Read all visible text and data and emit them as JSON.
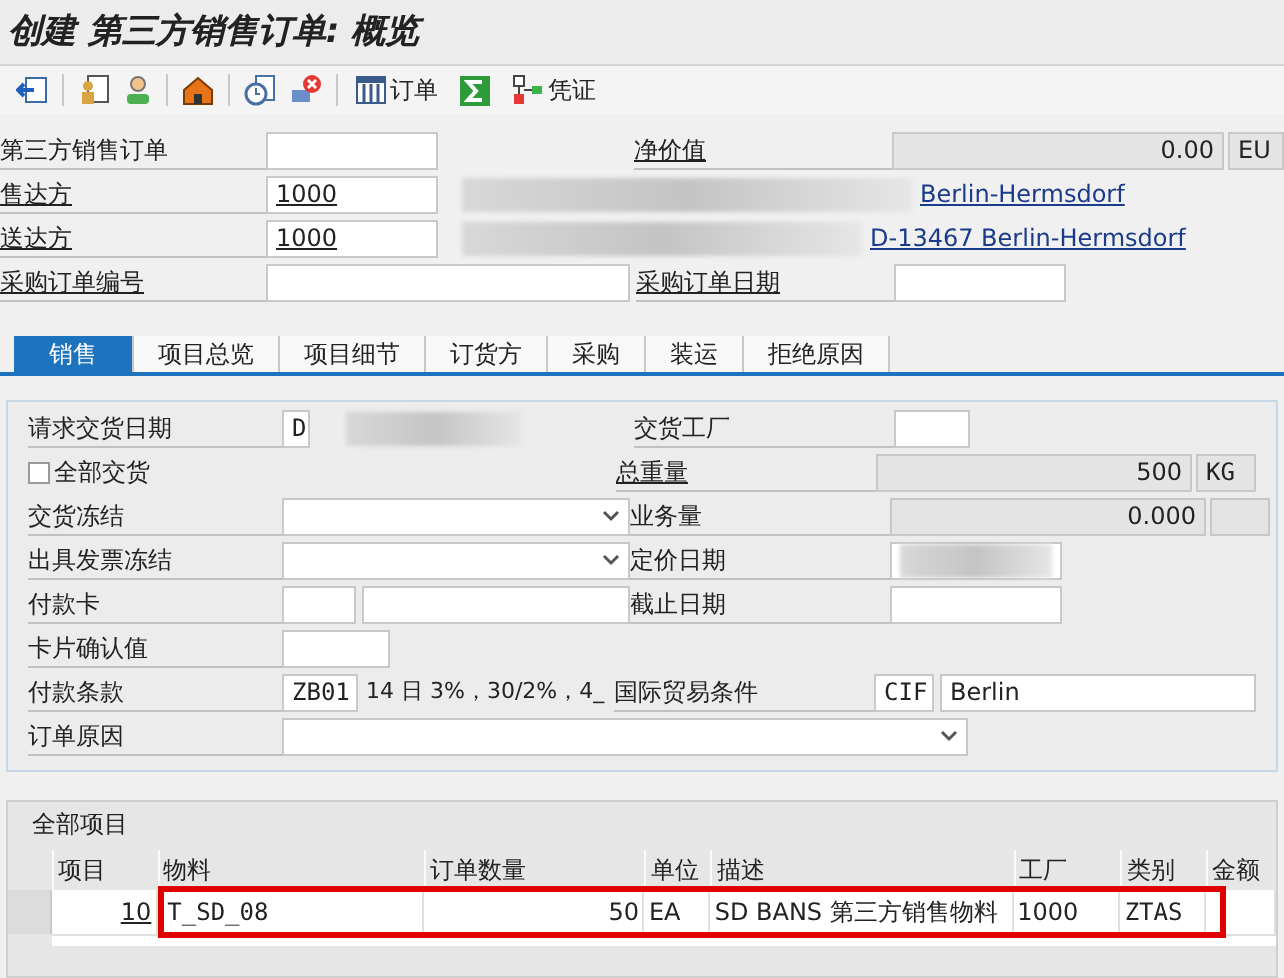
{
  "window": {
    "title": "创建 第三方销售订单: 概览"
  },
  "toolbar": {
    "order_button": "订单",
    "document_button": "凭证"
  },
  "header": [
    {
      "label": "第三方销售订单",
      "right_label": "净价值",
      "right_value": "0.00",
      "unit": "EU"
    },
    {
      "label": "售达方",
      "value": "1000",
      "address": "Berlin-Hermsdorf"
    },
    {
      "label": "送达方",
      "value": "1000",
      "address": "D-13467 Berlin-Hermsdorf"
    },
    {
      "label": "采购订单编号",
      "right_label": "采购订单日期"
    }
  ],
  "tabs": [
    {
      "label": "销售",
      "selected": true
    },
    {
      "label": "项目总览",
      "selected": false
    },
    {
      "label": "项目细节",
      "selected": false
    },
    {
      "label": "订货方",
      "selected": false
    },
    {
      "label": "采购",
      "selected": false
    },
    {
      "label": "装运",
      "selected": false
    },
    {
      "label": "拒绝原因",
      "selected": false
    }
  ],
  "sales": {
    "requested_date": {
      "label": "请求交货日期",
      "type": "D"
    },
    "complete_delivery": {
      "label": "全部交货",
      "checked": false
    },
    "delivery_block": {
      "label": "交货冻结"
    },
    "billing_block": {
      "label": "出具发票冻结"
    },
    "payment_card": {
      "label": "付款卡"
    },
    "card_verification": {
      "label": "卡片确认值"
    },
    "payment_terms": {
      "label": "付款条款",
      "value": "ZB01",
      "description": "14 日 3%，30/2%，4_"
    },
    "order_reason": {
      "label": "订单原因"
    },
    "delivering_plant": {
      "label": "交货工厂"
    },
    "total_weight": {
      "label": "总重量",
      "value": "500",
      "unit": "KG"
    },
    "volume": {
      "label": "业务量",
      "value": "0.000"
    },
    "pricing_date": {
      "label": "定价日期"
    },
    "expiry_date": {
      "label": "截止日期"
    },
    "incoterms": {
      "label": "国际贸易条件",
      "value": "CIF",
      "location": "Berlin"
    }
  },
  "items": {
    "title": "全部项目",
    "columns": [
      "项目",
      "物料",
      "订单数量",
      "单位",
      "描述",
      "工厂",
      "类别",
      "金额"
    ],
    "rows": [
      [
        "10",
        "T_SD_08",
        "50",
        "EA",
        "SD BANS 第三方销售物料",
        "1000",
        "ZTAS"
      ]
    ]
  }
}
